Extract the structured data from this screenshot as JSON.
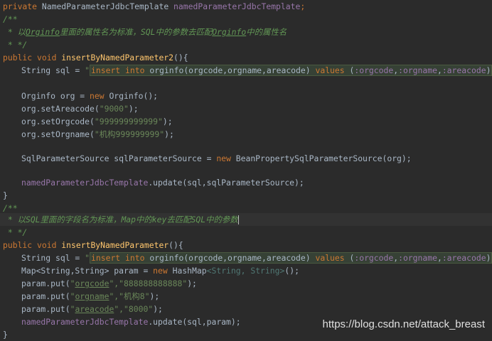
{
  "line1": {
    "kw": "private",
    "type": "NamedParameterJdbcTemplate",
    "field": "namedParameterJdbcTemplate",
    "end": ";"
  },
  "c1": {
    "open": "/**",
    "l2_a": " * 以",
    "l2_u1": "Orginfo",
    "l2_b": "里面的属性名为标准，SQL中的参数去匹配",
    "l2_u2": "Orginfo",
    "l2_c": "中的属性名",
    "close": " * */"
  },
  "m1": {
    "sig_kw": "public void ",
    "name": "insertByNamedParameter2",
    "sig_end": "(){"
  },
  "sql1": {
    "pre": "String sql = ",
    "q": "\"",
    "ins": "insert into ",
    "tbl": "orginfo(orgcode,orgname,areacode) ",
    "vals": "values ",
    "params_open": "(",
    "p1": ":orgcode",
    ",": ",",
    "p2": ":orgname",
    "p3": ":areacode",
    "close": ")",
    "end": "\";"
  },
  "org": {
    "decl_a": "Orginfo org = ",
    "decl_new": "new ",
    "decl_b": "Orginfo();",
    "s1_a": "org.setAreacode(",
    "s1_v": "\"9000\"",
    "s1_b": ");",
    "s2_a": "org.setOrgcode(",
    "s2_v": "\"999999999999\"",
    "s2_b": ");",
    "s3_a": "org.setOrgname(",
    "s3_v": "\"机构999999999\"",
    "s3_b": ");"
  },
  "src": {
    "a": "SqlParameterSource sqlParameterSource = ",
    "new": "new ",
    "b": "BeanPropertySqlParameterSource(org);"
  },
  "upd1": {
    "field": "namedParameterJdbcTemplate",
    "rest": ".update(sql,sqlParameterSource);"
  },
  "brace_close": "}",
  "c2": {
    "open": "/**",
    "l2": " * 以SQL里面的字段名为标准，Map中的key去匹配SQL中的参数",
    "close": " * */"
  },
  "m2": {
    "sig_kw": "public void ",
    "name": "insertByNamedParameter",
    "sig_end": "(){"
  },
  "map": {
    "decl_a": "Map<String,String> param = ",
    "decl_new": "new ",
    "decl_b": "HashMap",
    "decl_gen": "<String, String>",
    "decl_c": "();",
    "p1_a": "param.put(",
    "p1_k": "orgcode",
    "p1_v": "\"888888888888\"",
    "p1_b": ");",
    "p2_a": "param.put(",
    "p2_k": "orgname",
    "p2_v": "\"机构8\"",
    "p2_b": ");",
    "p3_a": "param.put(",
    "p3_k": "areacode",
    "p3_v": "\"8000\"",
    "p3_b": ");"
  },
  "upd2": {
    "field": "namedParameterJdbcTemplate",
    "rest": ".update(sql,param);"
  },
  "watermark": "https://blog.csdn.net/attack_breast",
  "colors": {
    "bg": "#2b2b2b",
    "keyword": "#cc7832",
    "method": "#ffc66d",
    "field": "#9876aa",
    "string": "#6a8759",
    "comment": "#629755",
    "text": "#a9b7c6"
  }
}
